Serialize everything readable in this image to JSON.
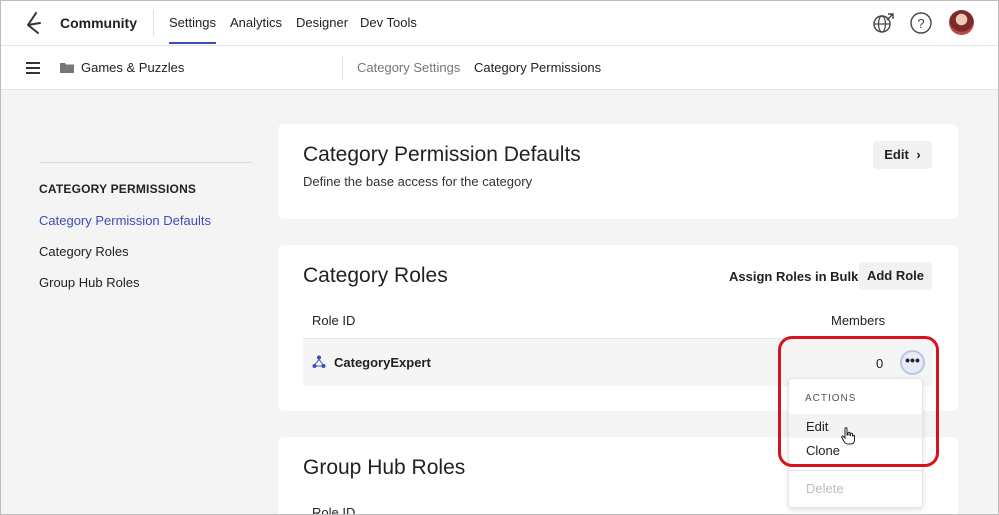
{
  "header": {
    "brand": "Community",
    "nav": [
      "Settings",
      "Analytics",
      "Designer",
      "Dev Tools"
    ],
    "active_nav": "Settings",
    "icons": [
      "globe-icon",
      "help-icon",
      "avatar"
    ]
  },
  "subheader": {
    "board": "Games & Puzzles",
    "tabs": [
      "Category Settings",
      "Category Permissions"
    ],
    "active_tab": "Category Permissions"
  },
  "sidebar": {
    "heading": "CATEGORY PERMISSIONS",
    "items": [
      "Category Permission Defaults",
      "Category Roles",
      "Group Hub Roles"
    ],
    "active_item": "Category Permission Defaults"
  },
  "defaults_card": {
    "title": "Category Permission Defaults",
    "description": "Define the base access for the category",
    "edit_label": "Edit"
  },
  "roles_card": {
    "title": "Category Roles",
    "assign_label": "Assign Roles in Bulk",
    "add_label": "Add Role",
    "col_role": "Role ID",
    "col_members": "Members",
    "rows": [
      {
        "role": "CategoryExpert",
        "members": "0",
        "more": "•••"
      }
    ]
  },
  "actions_menu": {
    "heading": "ACTIONS",
    "items": [
      "Edit",
      "Clone",
      "Delete"
    ],
    "hovered_item": "Edit",
    "disabled_item": "Delete"
  },
  "group_hub_card": {
    "title": "Group Hub Roles",
    "col_role": "Role ID"
  },
  "colors": {
    "accent": "#3a4fb5",
    "highlight": "#d8131b"
  }
}
